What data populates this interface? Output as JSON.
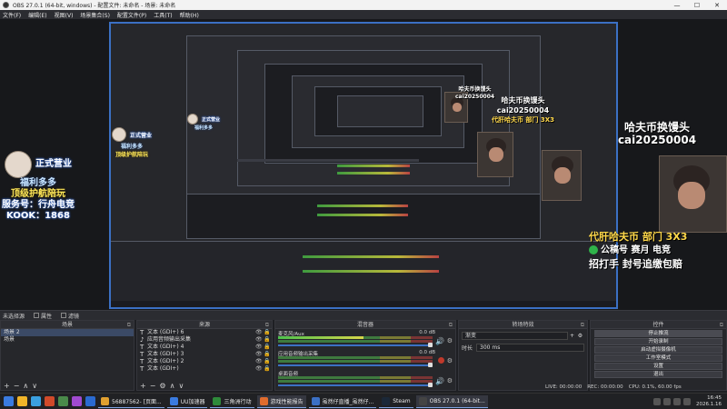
{
  "window": {
    "title": "OBS 27.0.1 (64-bit, windows) - 配置文件: 未命名 - 场景: 未命名",
    "controls": [
      "—",
      "☐",
      "✕"
    ]
  },
  "menu": [
    "文件(F)",
    "编辑(E)",
    "视图(V)",
    "场景集合(S)",
    "配置文件(P)",
    "工具(T)",
    "帮助(H)"
  ],
  "overlays": {
    "left_badge": {
      "line1": "正式营业",
      "line2": "福利多多",
      "line3": "顶级护航陪玩",
      "line4": "服务号：行舟电竞",
      "line5": "KOOK：1868"
    },
    "right_promo": {
      "line1": "哈夫币换馒头",
      "line2": "cai20250004",
      "line3": "代肝哈夫币 部门 3X3",
      "line4": "公稿号 赛月 电竞",
      "line5": "招打手 封号追缴包赔"
    }
  },
  "dock_bar": {
    "label": "未选择源",
    "properties": "属性",
    "filters": "滤镜"
  },
  "scenes": {
    "header": "场景",
    "items": [
      "场景 2",
      "场景"
    ],
    "footer": [
      "+",
      "−",
      "∧",
      "∨"
    ]
  },
  "sources": {
    "header": "来源",
    "items": [
      {
        "icon": "T",
        "name": "文本 (GDI+) 6"
      },
      {
        "icon": "♪",
        "name": "应用音频输出采集"
      },
      {
        "icon": "T",
        "name": "文本 (GDI+) 4"
      },
      {
        "icon": "T",
        "name": "文本 (GDI+) 3"
      },
      {
        "icon": "T",
        "name": "文本 (GDI+) 2"
      },
      {
        "icon": "T",
        "name": "文本 (GDI+)"
      }
    ],
    "footer": [
      "+",
      "−",
      "⚙",
      "∧",
      "∨"
    ]
  },
  "mixer": {
    "header": "混音器",
    "channels": [
      {
        "name": "麦克风/Aux",
        "db": "0.0 dB",
        "level": 0.55,
        "fader": 1.0,
        "muted": false
      },
      {
        "name": "应用音频输出采集",
        "db": "0.0 dB",
        "level": 0.0,
        "fader": 1.0,
        "muted": true
      },
      {
        "name": "桌面音频",
        "db": "",
        "level": 0.0,
        "fader": 1.0,
        "muted": false
      }
    ]
  },
  "transitions": {
    "header": "转场特效",
    "selected": "渐变",
    "duration_label": "时长",
    "duration": "300 ms"
  },
  "controls": {
    "header": "控件",
    "buttons": [
      "停止推流",
      "开始录制",
      "启动虚拟摄像机",
      "工作室模式",
      "设置",
      "退出"
    ]
  },
  "statusbar": {
    "live": "LIVE: 00:00:00",
    "rec": "REC: 00:00:00",
    "cpu": "CPU: 0.1%, 60.00 fps"
  },
  "taskbar": {
    "apps": [
      {
        "label": "56887562- [页面...",
        "color": "#e0a030"
      },
      {
        "label": "UU加速器",
        "color": "#3a7be0"
      },
      {
        "label": "三角洲行动",
        "color": "#2e8a3a"
      },
      {
        "label": "游戏性能报告",
        "color": "#e06c2e",
        "active": true
      },
      {
        "label": "虽然仔直播_虽然仔...",
        "color": "#3b70c4"
      },
      {
        "label": "Steam",
        "color": "#1b2838"
      },
      {
        "label": "OBS 27.0.1 (64-bit...",
        "color": "#444",
        "active": true
      }
    ],
    "time": "16:45",
    "date": "2026.1.16"
  }
}
